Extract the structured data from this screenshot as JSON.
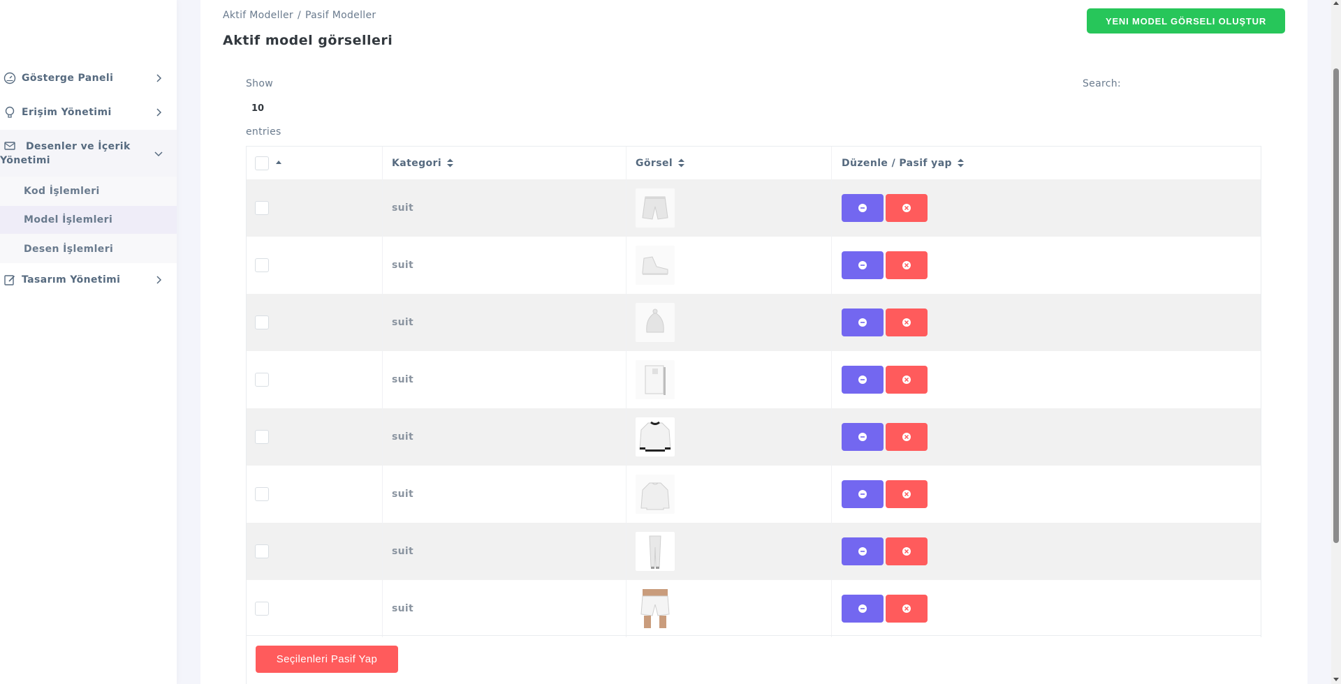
{
  "sidebar": {
    "items": [
      {
        "label": "Gösterge Paneli",
        "icon": "gauge-icon"
      },
      {
        "label": "Erişim Yönetimi",
        "icon": "lightbulb-icon"
      },
      {
        "label": "Desenler ve İçerik Yönetimi",
        "icon": "mail-icon"
      },
      {
        "label": "Tasarım Yönetimi",
        "icon": "edit-icon"
      }
    ],
    "submenu": [
      {
        "label": "Kod İşlemleri"
      },
      {
        "label": "Model İşlemleri"
      },
      {
        "label": "Desen İşlemleri"
      }
    ]
  },
  "breadcrumb": {
    "active": "Aktif Modeller",
    "separator": "/",
    "passive": "Pasif Modeller"
  },
  "page": {
    "title": "Aktif model görselleri",
    "new_button": "YENI MODEL GÖRSELI OLUŞTUR",
    "bulk_button": "Seçilenleri Pasif Yap"
  },
  "datatable": {
    "show_label": "Show",
    "page_size": "10",
    "entries_label": "entries",
    "search_label": "Search:",
    "columns": [
      "Kategori",
      "Görsel",
      "Düzenle / Pasif yap"
    ]
  },
  "rows": [
    {
      "category": "suit",
      "image": "shorts-thumbnail"
    },
    {
      "category": "suit",
      "image": "sneaker-thumbnail"
    },
    {
      "category": "suit",
      "image": "beanie-thumbnail"
    },
    {
      "category": "suit",
      "image": "tag-thumbnail"
    },
    {
      "category": "suit",
      "image": "bomber-jacket-thumbnail"
    },
    {
      "category": "suit",
      "image": "sweatshirt-thumbnail"
    },
    {
      "category": "suit",
      "image": "sweatpants-thumbnail"
    },
    {
      "category": "suit",
      "image": "model-shorts-thumbnail"
    }
  ],
  "colors": {
    "primary": "#7367f0",
    "danger": "#ff5b5c",
    "success": "#27c65a",
    "text": "#566a7f",
    "stripe": "#f1f1f1"
  }
}
